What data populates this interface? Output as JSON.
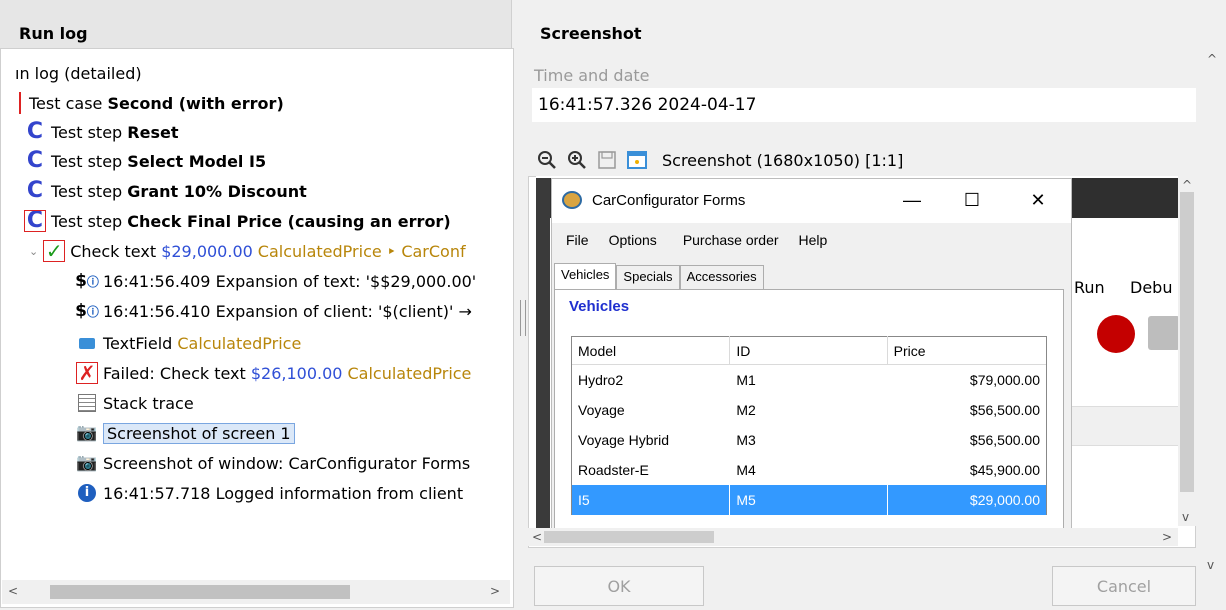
{
  "left_pane": {
    "title": "Run log",
    "tree": [
      {
        "text": "ın log (detailed)"
      },
      {
        "prefix": "Test case ",
        "bold": "Second (with error)"
      },
      {
        "prefix": "Test step ",
        "bold": "Reset"
      },
      {
        "prefix": "Test step ",
        "bold": "Select Model I5"
      },
      {
        "prefix": "Test step ",
        "bold": "Grant 10% Discount"
      },
      {
        "prefix": "Test step ",
        "bold": "Check Final Price (causing an error)"
      },
      {
        "prefix": "Check text ",
        "blue": "$29,000.00",
        "gold": "CalculatedPrice ‣ CarConf"
      },
      {
        "text": "16:41:56.409 Expansion of text: '$$29,000.00'"
      },
      {
        "text": "16:41:56.410 Expansion of client: '$(client)' →"
      },
      {
        "prefix": "TextField ",
        "gold": "CalculatedPrice"
      },
      {
        "prefix": "Failed: Check text ",
        "blue": "$26,100.00",
        "gold": "CalculatedPrice"
      },
      {
        "text": "Stack trace"
      },
      {
        "text": "Screenshot of screen 1"
      },
      {
        "text": "Screenshot of window: CarConfigurator Forms"
      },
      {
        "text": "16:41:57.718 Logged information from client"
      }
    ]
  },
  "right_pane": {
    "title": "Screenshot",
    "time_label": "Time and date",
    "time_value": "16:41:57.326  2024-04-17",
    "toolbar": {
      "icons": [
        "zoom-out-icon",
        "zoom-in-icon",
        "save-icon",
        "window-icon"
      ],
      "caption": "Screenshot (1680x1050) [1:1]"
    },
    "background_app": {
      "run": "Run",
      "debug": "Debu"
    },
    "inner_window": {
      "title": "CarConfigurator Forms",
      "controls": [
        "—",
        "☐",
        "✕"
      ],
      "menu": [
        "File",
        "Options",
        "Purchase order",
        "Help"
      ],
      "tabs": [
        "Vehicles",
        "Specials",
        "Accessories"
      ],
      "section": "Vehicles",
      "columns": [
        "Model",
        "ID",
        "Price"
      ],
      "rows": [
        [
          "Hydro2",
          "M1",
          "$79,000.00"
        ],
        [
          "Voyage",
          "M2",
          "$56,500.00"
        ],
        [
          "Voyage Hybrid",
          "M3",
          "$56,500.00"
        ],
        [
          "Roadster-E",
          "M4",
          "$45,900.00"
        ],
        [
          "I5",
          "M5",
          "$29,000.00"
        ]
      ],
      "selected_row": 4
    },
    "buttons": {
      "ok": "OK",
      "cancel": "Cancel"
    }
  },
  "colors": {
    "accent_blue": "#2f4fd6",
    "name_gold": "#b8860b",
    "selection": "#3399ff",
    "error_red": "#c40000"
  }
}
